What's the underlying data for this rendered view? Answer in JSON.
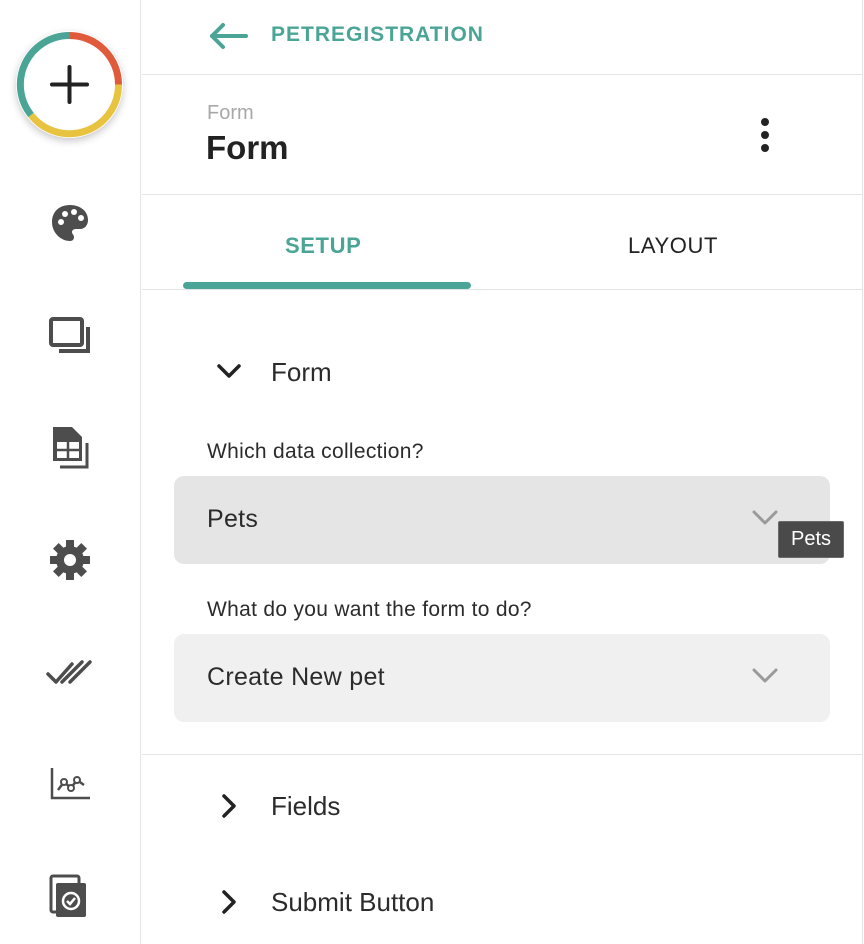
{
  "rail": {
    "add_icon": "plus-icon",
    "icons": [
      "palette-icon",
      "layers-icon",
      "spreadsheet-icon",
      "gear-icon",
      "double-check-icon",
      "line-chart-icon",
      "document-check-icon"
    ],
    "ring_colors": [
      "#4aa596",
      "#e05a3c",
      "#e8c340"
    ]
  },
  "topbar": {
    "back_label": "PETREGISTRATION",
    "back_icon": "arrow-left-icon"
  },
  "header": {
    "subtitle": "Form",
    "title": "Form",
    "menu_icon": "more-vertical-icon"
  },
  "tabs": {
    "setup": "SETUP",
    "layout": "LAYOUT",
    "active": "SETUP"
  },
  "sections": {
    "form": {
      "label": "Form",
      "expanded": true
    },
    "fields": {
      "label": "Fields",
      "expanded": false
    },
    "submit": {
      "label": "Submit Button",
      "expanded": false
    }
  },
  "collection": {
    "label": "Which data collection?",
    "value": "Pets",
    "tooltip": "Pets"
  },
  "action": {
    "label": "What do you want the form to do?",
    "value": "Create New pet"
  },
  "colors": {
    "accent": "#4aa596"
  }
}
